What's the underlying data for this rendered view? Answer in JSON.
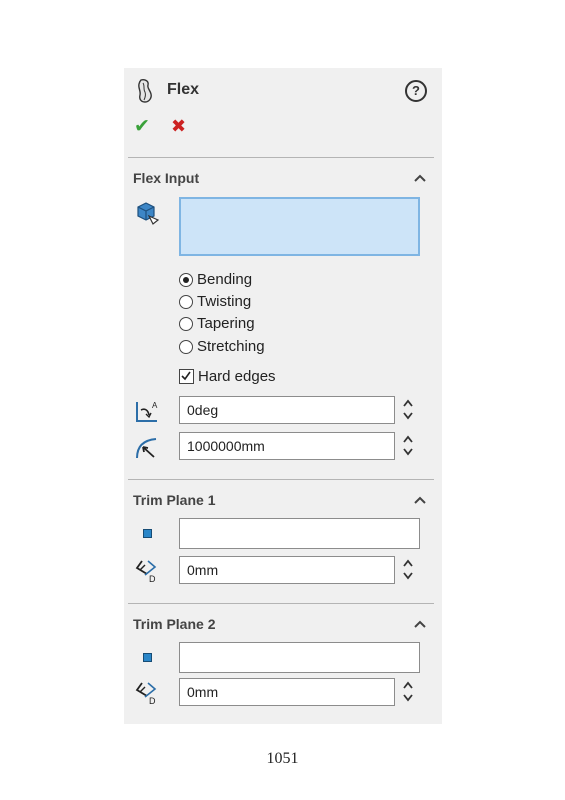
{
  "header": {
    "title": "Flex",
    "help_label": "?"
  },
  "actions": {
    "ok_glyph": "✔",
    "cancel_glyph": "✖"
  },
  "flex_input": {
    "title": "Flex Input",
    "bodies_selection": "",
    "modes": [
      {
        "label": "Bending",
        "selected": true
      },
      {
        "label": "Twisting",
        "selected": false
      },
      {
        "label": "Tapering",
        "selected": false
      },
      {
        "label": "Stretching",
        "selected": false
      }
    ],
    "hard_edges": {
      "label": "Hard edges",
      "checked": true
    },
    "angle": "0deg",
    "radius": "1000000mm"
  },
  "trim_plane_1": {
    "title": "Trim Plane 1",
    "selection": "",
    "distance": "0mm"
  },
  "trim_plane_2": {
    "title": "Trim Plane 2",
    "selection": "",
    "distance": "0mm"
  },
  "page_number": "1051",
  "colors": {
    "ok": "#3aa13a",
    "cancel": "#cc2222",
    "selection_fill": "#cde4f8",
    "selection_border": "#7fb5e3",
    "icon_blue": "#2c6ea8"
  }
}
